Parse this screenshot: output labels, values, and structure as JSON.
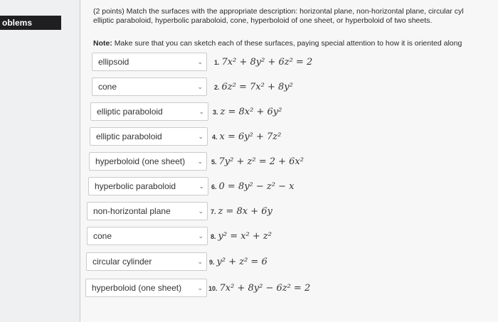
{
  "sidebar": {
    "tab_label": "oblems"
  },
  "question": {
    "line1": "(2 points) Match the surfaces with the appropriate description: horizontal plane, non-horizontal plane, circular cyl",
    "line2": "elliptic paraboloid, hyperbolic paraboloid, cone, hyperboloid of one sheet, or hyperboloid of two sheets.",
    "note_prefix": "Note:",
    "note_text": " Make sure that you can sketch each of these surfaces, paying special attention to how it is oriented along"
  },
  "items": [
    {
      "selected": "ellipsoid",
      "num": "1.",
      "eq": "7x² + 8y² + 6z² = 2"
    },
    {
      "selected": "cone",
      "num": "2.",
      "eq": "6z² = 7x² + 8y²"
    },
    {
      "selected": "elliptic paraboloid",
      "num": "3.",
      "eq": "z = 8x² + 6y²"
    },
    {
      "selected": "elliptic paraboloid",
      "num": "4.",
      "eq": "x = 6y² + 7z²"
    },
    {
      "selected": "hyperboloid (one sheet)",
      "num": "5.",
      "eq": "7y² + z² = 2 + 6x²"
    },
    {
      "selected": "hyperbolic paraboloid",
      "num": "6.",
      "eq": "0 = 8y² − z² − x"
    },
    {
      "selected": "non-horizontal plane",
      "num": "7.",
      "eq": "z = 8x + 6y"
    },
    {
      "selected": "cone",
      "num": "8.",
      "eq": "y² = x² + z²"
    },
    {
      "selected": "circular cylinder",
      "num": "9.",
      "eq": "y² + z² = 6"
    },
    {
      "selected": "hyperboloid (one sheet)",
      "num": "10.",
      "eq": "7x² + 8y² − 6z² = 2"
    }
  ]
}
